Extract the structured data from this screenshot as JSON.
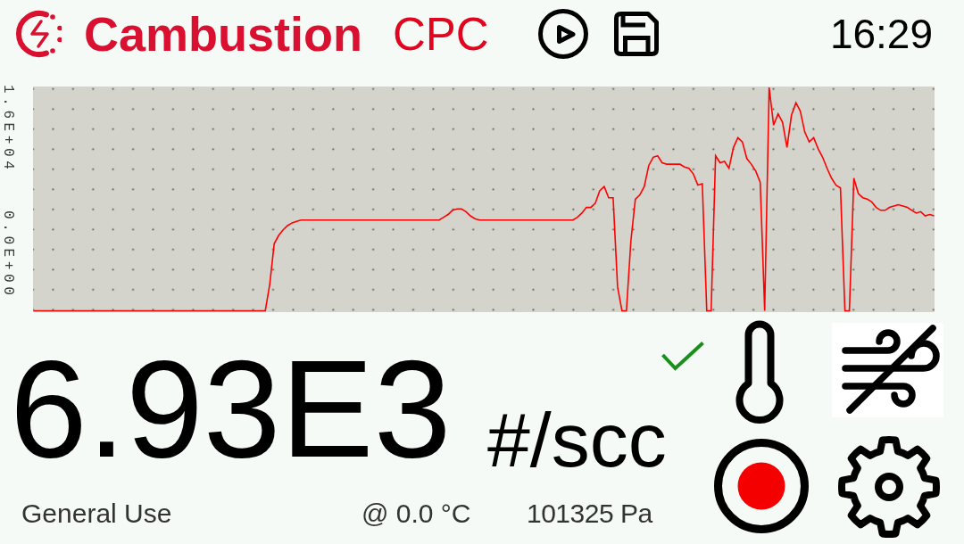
{
  "header": {
    "brand": "Cambustion",
    "product": "CPC",
    "time": "16:29"
  },
  "graph": {
    "axis_labels": [
      "1.6E+04",
      "0.0E+00"
    ]
  },
  "reading": {
    "value": "6.93E3",
    "unit": "#/scc",
    "ok": true
  },
  "footer": {
    "mode": "General Use",
    "temperature": "@ 0.0 °C",
    "pressure": "101325 Pa"
  }
}
